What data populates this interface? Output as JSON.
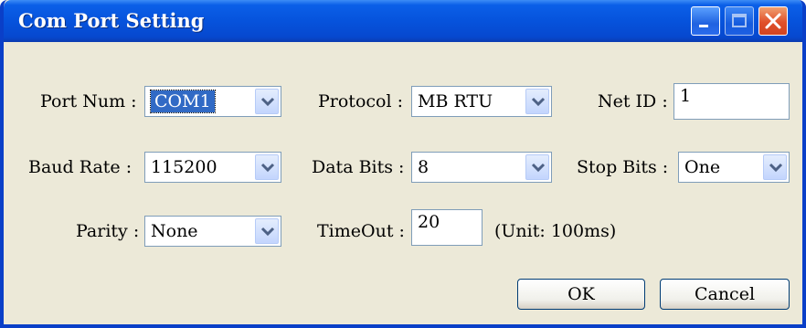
{
  "window": {
    "title": "Com Port Setting"
  },
  "fields": {
    "port_num": {
      "label": "Port Num :",
      "value": "COM1"
    },
    "protocol": {
      "label": "Protocol :",
      "value": "MB RTU"
    },
    "net_id": {
      "label": "Net ID :",
      "value": "1"
    },
    "baud_rate": {
      "label": "Baud Rate :",
      "value": "115200"
    },
    "data_bits": {
      "label": "Data Bits :",
      "value": "8"
    },
    "stop_bits": {
      "label": "Stop Bits :",
      "value": "One"
    },
    "parity": {
      "label": "Parity :",
      "value": "None"
    },
    "timeout": {
      "label": "TimeOut :",
      "value": "20",
      "unit": "(Unit: 100ms)"
    }
  },
  "buttons": {
    "ok": "OK",
    "cancel": "Cancel"
  },
  "icons": {
    "minimize": "minimize-icon",
    "maximize": "maximize-icon",
    "close": "close-icon",
    "dropdown": "chevron-down-icon"
  },
  "colors": {
    "titlebar": "#0653dc",
    "dialog_bg": "#ece9d8",
    "close_button": "#e0502a",
    "selection": "#316ac5"
  }
}
